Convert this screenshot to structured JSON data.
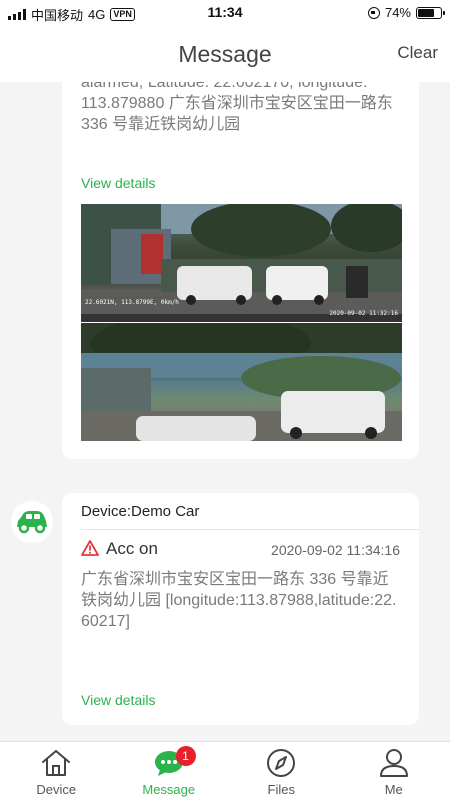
{
  "status_bar": {
    "carrier": "中国移动",
    "network": "4G",
    "vpn": "VPN",
    "time": "11:34",
    "battery": "74%",
    "battery_level": 0.74
  },
  "header": {
    "title": "Message",
    "clear_label": "Clear"
  },
  "messages": [
    {
      "address": "alarmed, Latitude: 22.602170, longitude: 113.879880 广东省深圳市宝安区宝田一路东 336 号靠近铁岗幼儿园",
      "view_details": "View details",
      "images": [
        {
          "overlay_left": "22.6021N, 113.8799E, 0km/h",
          "overlay_right": "2020-09-02 11:32:16"
        },
        {
          "overlay_left": ""
        }
      ]
    },
    {
      "device": "Device:Demo Car",
      "event": "Acc on",
      "time": "2020-09-02 11:34:16",
      "detail": "广东省深圳市宝安区宝田一路东 336 号靠近铁岗幼儿园 [longitude:113.87988,latitude:22.60217]",
      "view_details": "View details",
      "avatar_icon": "car-icon"
    }
  ],
  "tabbar": {
    "tabs": [
      {
        "label": "Device",
        "icon": "home-icon"
      },
      {
        "label": "Message",
        "icon": "chat-icon",
        "badge": "1"
      },
      {
        "label": "Files",
        "icon": "compass-icon"
      },
      {
        "label": "Me",
        "icon": "user-icon"
      }
    ]
  },
  "colors": {
    "accent": "#2bb24c",
    "badge": "#e8202a",
    "warning": "#e23a3a"
  }
}
